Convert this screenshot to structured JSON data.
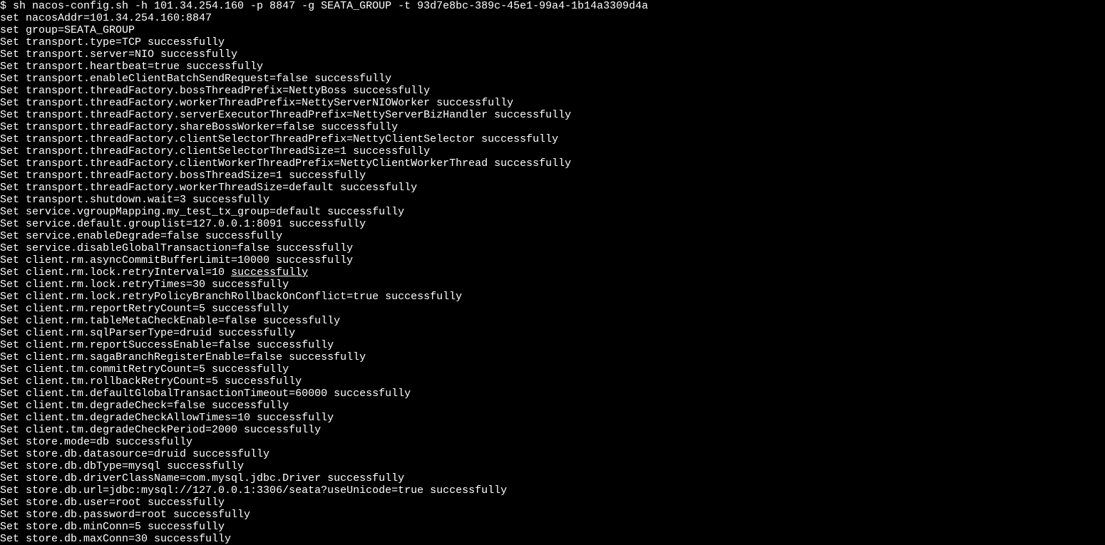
{
  "terminal": {
    "lines": [
      "$ sh nacos-config.sh -h 101.34.254.160 -p 8847 -g SEATA_GROUP -t 93d7e8bc-389c-45e1-99a4-1b14a3309d4a",
      "set nacosAddr=101.34.254.160:8847",
      "set group=SEATA_GROUP",
      "Set transport.type=TCP successfully",
      "Set transport.server=NIO successfully",
      "Set transport.heartbeat=true successfully",
      "Set transport.enableClientBatchSendRequest=false successfully",
      "Set transport.threadFactory.bossThreadPrefix=NettyBoss successfully",
      "Set transport.threadFactory.workerThreadPrefix=NettyServerNIOWorker successfully",
      "Set transport.threadFactory.serverExecutorThreadPrefix=NettyServerBizHandler successfully",
      "Set transport.threadFactory.shareBossWorker=false successfully",
      "Set transport.threadFactory.clientSelectorThreadPrefix=NettyClientSelector successfully",
      "Set transport.threadFactory.clientSelectorThreadSize=1 successfully",
      "Set transport.threadFactory.clientWorkerThreadPrefix=NettyClientWorkerThread successfully",
      "Set transport.threadFactory.bossThreadSize=1 successfully",
      "Set transport.threadFactory.workerThreadSize=default successfully",
      "Set transport.shutdown.wait=3 successfully",
      "Set service.vgroupMapping.my_test_tx_group=default successfully",
      "Set service.default.grouplist=127.0.0.1:8091 successfully",
      "Set service.enableDegrade=false successfully",
      "Set service.disableGlobalTransaction=false successfully",
      "Set client.rm.asyncCommitBufferLimit=10000 successfully",
      "Set client.rm.lock.retryInterval=10 ",
      "Set client.rm.lock.retryTimes=30 successfully",
      "Set client.rm.lock.retryPolicyBranchRollbackOnConflict=true successfully",
      "Set client.rm.reportRetryCount=5 successfully",
      "Set client.rm.tableMetaCheckEnable=false successfully",
      "Set client.rm.sqlParserType=druid successfully",
      "Set client.rm.reportSuccessEnable=false successfully",
      "Set client.rm.sagaBranchRegisterEnable=false successfully",
      "Set client.tm.commitRetryCount=5 successfully",
      "Set client.tm.rollbackRetryCount=5 successfully",
      "Set client.tm.defaultGlobalTransactionTimeout=60000 successfully",
      "Set client.tm.degradeCheck=false successfully",
      "Set client.tm.degradeCheckAllowTimes=10 successfully",
      "Set client.tm.degradeCheckPeriod=2000 successfully",
      "Set store.mode=db successfully",
      "Set store.db.datasource=druid successfully",
      "Set store.db.dbType=mysql successfully",
      "Set store.db.driverClassName=com.mysql.jdbc.Driver successfully",
      "Set store.db.url=jdbc:mysql://127.0.0.1:3306/seata?useUnicode=true successfully",
      "Set store.db.user=root successfully",
      "Set store.db.password=root successfully",
      "Set store.db.minConn=5 successfully",
      "Set store.db.maxConn=30 successfully"
    ],
    "underlineWord": "successfully",
    "underlineLineIndex": 22
  }
}
